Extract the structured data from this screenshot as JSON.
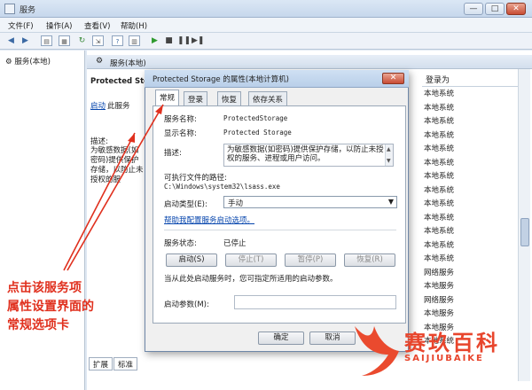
{
  "window": {
    "title": "服务",
    "buttons": {
      "min": "—",
      "max": "□",
      "close": "✕"
    }
  },
  "menu": [
    "文件(F)",
    "操作(A)",
    "查看(V)",
    "帮助(H)"
  ],
  "tree": {
    "item": "服务(本地)"
  },
  "main": {
    "header": "服务(本地)",
    "service_name": "Protected Stor",
    "start_link": "启动",
    "start_suffix": "此服务",
    "desc_label": "描述:",
    "desc_text": "为敏感数据(如密码)提供保护存储，以防止未授权的服"
  },
  "logon": {
    "header": "登录为",
    "rows": [
      "本地系统",
      "本地系统",
      "本地系统",
      "本地系统",
      "本地系统",
      "本地系统",
      "本地系统",
      "本地系统",
      "本地系统",
      "本地系统",
      "本地系统",
      "本地系统",
      "本地系统",
      "网络服务",
      "本地服务",
      "网络服务",
      "本地服务",
      "本地服务",
      "本地系统"
    ]
  },
  "bottom_tabs": [
    "扩展",
    "标准"
  ],
  "dialog": {
    "title": "Protected Storage 的属性(本地计算机)",
    "close": "✕",
    "tabs": [
      "常规",
      "登录",
      "恢复",
      "依存关系"
    ],
    "service_name_label": "服务名称:",
    "service_name_value": "ProtectedStorage",
    "display_name_label": "显示名称:",
    "display_name_value": "Protected Storage",
    "desc_label": "描述:",
    "desc_value": "为敏感数据(如密码)提供保护存储，以防止未授权的服务、进程或用户访问。",
    "path_label": "可执行文件的路径:",
    "path_value": "C:\\Windows\\system32\\lsass.exe",
    "startup_type_label": "启动类型(E):",
    "startup_type_value": "手动",
    "help_link": "帮助我配置服务启动选项。",
    "status_label": "服务状态:",
    "status_value": "已停止",
    "btn_start": "启动(S)",
    "btn_stop": "停止(T)",
    "btn_pause": "暂停(P)",
    "btn_resume": "恢复(R)",
    "hint": "当从此处启动服务时，您可指定所适用的启动参数。",
    "param_label": "启动参数(M):",
    "btn_ok": "确定",
    "btn_cancel": "取消"
  },
  "annotation": {
    "lines": [
      "点击该服务项",
      "属性设置界面的",
      "常规选项卡"
    ],
    "color": "#e0301e"
  },
  "watermark": {
    "text": "赛玖百科",
    "sub": "SAIJIUBAIKE",
    "color": "#e8452c"
  }
}
